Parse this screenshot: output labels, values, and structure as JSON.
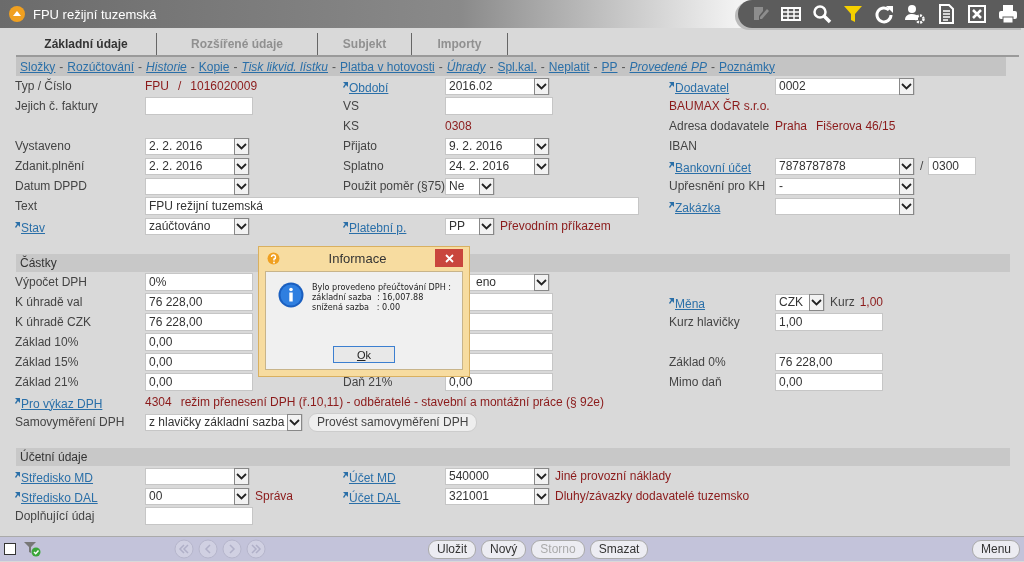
{
  "window": {
    "title": "FPU režijní tuzemská"
  },
  "toolbar": [
    {
      "kind": "edit",
      "disabled": true
    },
    {
      "kind": "table",
      "disabled": false
    },
    {
      "kind": "search",
      "disabled": false
    },
    {
      "kind": "filter",
      "disabled": false
    },
    {
      "kind": "refresh",
      "disabled": false
    },
    {
      "kind": "user-settings",
      "disabled": false
    },
    {
      "kind": "document",
      "disabled": false
    },
    {
      "kind": "excel",
      "disabled": false
    },
    {
      "kind": "print",
      "disabled": false
    }
  ],
  "tabs": [
    {
      "label": "Základní údaje",
      "selected": true
    },
    {
      "label": "Rozšířené údaje",
      "selected": false
    },
    {
      "label": "Subjekt",
      "selected": false
    },
    {
      "label": "Importy",
      "selected": false
    }
  ],
  "links": {
    "separator": "-",
    "items": [
      {
        "label": "Složky",
        "italic": false
      },
      {
        "label": "Rozúčtování",
        "italic": false
      },
      {
        "label": "Historie",
        "italic": true
      },
      {
        "label": "Kopie",
        "italic": false
      },
      {
        "label": "Tisk likvid. lístku",
        "italic": true
      },
      {
        "label": "Platba v hotovosti",
        "italic": false
      },
      {
        "label": "Úhrady",
        "italic": true
      },
      {
        "label": "Spl.kal.",
        "italic": false
      },
      {
        "label": "Neplatit",
        "italic": false
      },
      {
        "label": "PP",
        "italic": false
      },
      {
        "label": "Provedené PP",
        "italic": true
      },
      {
        "label": "Poznámky",
        "italic": false
      }
    ]
  },
  "sections": [
    {
      "rows": [
        {
          "cells": [
            {
              "label": "Typ / Číslo",
              "kind": "plain",
              "fields": [
                {
                  "kind": "text",
                  "text": "FPU"
                },
                {
                  "kind": "text",
                  "text": "/"
                },
                {
                  "kind": "text",
                  "text": "1016020009"
                }
              ]
            },
            {
              "label": "Období",
              "kind": "link",
              "fields": [
                {
                  "kind": "select",
                  "text": "2016.02"
                }
              ]
            },
            {
              "label": "Dodavatel",
              "kind": "link",
              "fields": [
                {
                  "kind": "select",
                  "text": "0002"
                }
              ]
            }
          ]
        },
        {
          "cells": [
            {
              "label": "Jejich č. faktury",
              "kind": "plain",
              "fields": [
                {
                  "kind": "input"
                }
              ]
            },
            {
              "label": "VS",
              "kind": "plain",
              "fields": [
                {
                  "kind": "input"
                }
              ]
            },
            {
              "label": "BAUMAX ČR s.r.o.",
              "kind": "value"
            }
          ]
        },
        {
          "cells": [
            null,
            {
              "label": "KS",
              "kind": "plain",
              "fields": [
                {
                  "kind": "text",
                  "text": "0308"
                }
              ]
            },
            {
              "label": "Adresa dodavatele",
              "kind": "plain",
              "fields": [
                {
                  "kind": "text",
                  "text": "Praha"
                },
                {
                  "kind": "text",
                  "text": "Fišerova 46/15"
                }
              ]
            }
          ]
        },
        {
          "cells": [
            {
              "label": "Vystaveno",
              "kind": "plain",
              "fields": [
                {
                  "kind": "select",
                  "text": "2. 2. 2016"
                }
              ]
            },
            {
              "label": "Přijato",
              "kind": "plain",
              "fields": [
                {
                  "kind": "select",
                  "text": "9. 2. 2016"
                }
              ]
            },
            {
              "label": "IBAN",
              "kind": "plain"
            }
          ]
        },
        {
          "cells": [
            {
              "label": "Zdanit.plnění",
              "kind": "plain",
              "fields": [
                {
                  "kind": "select",
                  "text": "2. 2. 2016"
                }
              ]
            },
            {
              "label": "Splatno",
              "kind": "plain",
              "fields": [
                {
                  "kind": "select",
                  "text": "24. 2. 2016"
                }
              ]
            },
            {
              "label": "Bankovní účet",
              "kind": "link",
              "fields": [
                {
                  "kind": "select",
                  "text": "7878787878"
                },
                {
                  "kind": "sep",
                  "text": "/"
                },
                {
                  "kind": "small-input",
                  "text": "0300"
                }
              ]
            }
          ]
        },
        {
          "cells": [
            {
              "label": "Datum DPPD",
              "kind": "plain",
              "fields": [
                {
                  "kind": "select"
                }
              ]
            },
            {
              "label": "Použit poměr (§75)",
              "kind": "plain",
              "fields": [
                {
                  "kind": "small-select",
                  "text": "Ne"
                }
              ]
            },
            {
              "label": "Upřesnění pro KH",
              "kind": "plain",
              "fields": [
                {
                  "kind": "select",
                  "text": "-"
                }
              ]
            }
          ]
        },
        {
          "cells": [
            {
              "label": "Text",
              "kind": "plain",
              "fields": [
                {
                  "kind": "input",
                  "text": "FPU režijní tuzemská"
                }
              ]
            },
            null,
            {
              "label": "Zakázka",
              "kind": "link",
              "fields": [
                {
                  "kind": "select"
                }
              ]
            }
          ]
        },
        {
          "cells": [
            {
              "label": "Stav",
              "kind": "link",
              "fields": [
                {
                  "kind": "select",
                  "text": "zaúčtováno"
                }
              ]
            },
            {
              "label": "Platební p.",
              "kind": "link",
              "fields": [
                {
                  "kind": "small-select",
                  "text": "PP"
                },
                {
                  "kind": "text",
                  "text": "Převodním příkazem"
                }
              ]
            },
            null
          ]
        }
      ]
    },
    {
      "title": "Částky",
      "rows": [
        {
          "cells": [
            {
              "label": "Výpočet DPH",
              "kind": "plain",
              "fields": [
                {
                  "kind": "input",
                  "text": "0%"
                }
              ]
            },
            {
              "fields": [
                {
                  "kind": "select",
                  "text": "eno",
                  "clipped": true
                }
              ]
            },
            null
          ]
        },
        {
          "cells": [
            {
              "label": "K úhradě val",
              "kind": "plain",
              "fields": [
                {
                  "kind": "input",
                  "text": "76 228,00"
                }
              ]
            },
            {
              "fields": [
                {
                  "kind": "input"
                }
              ]
            },
            {
              "label": "Měna",
              "kind": "link",
              "fields": [
                {
                  "kind": "small-select",
                  "text": "CZK"
                },
                {
                  "kind": "caption",
                  "text": "Kurz"
                },
                {
                  "kind": "text",
                  "text": "1,00"
                }
              ]
            }
          ]
        },
        {
          "cells": [
            {
              "label": "K úhradě CZK",
              "kind": "plain",
              "fields": [
                {
                  "kind": "input",
                  "text": "76 228,00"
                }
              ]
            },
            {
              "fields": [
                {
                  "kind": "input"
                }
              ]
            },
            {
              "label": "Kurz hlavičky",
              "kind": "plain",
              "fields": [
                {
                  "kind": "input",
                  "text": "1,00"
                }
              ]
            }
          ]
        },
        {
          "cells": [
            {
              "label": "Základ 10%",
              "kind": "plain",
              "fields": [
                {
                  "kind": "input",
                  "text": "0,00"
                }
              ]
            },
            {
              "fields": [
                {
                  "kind": "input"
                }
              ]
            },
            null
          ]
        },
        {
          "cells": [
            {
              "label": "Základ 15%",
              "kind": "plain",
              "fields": [
                {
                  "kind": "input",
                  "text": "0,00"
                }
              ]
            },
            {
              "fields": [
                {
                  "kind": "input"
                }
              ]
            },
            {
              "label": "Základ 0%",
              "kind": "plain",
              "fields": [
                {
                  "kind": "input",
                  "text": "76 228,00"
                }
              ]
            }
          ]
        },
        {
          "cells": [
            {
              "label": "Základ 21%",
              "kind": "plain",
              "fields": [
                {
                  "kind": "input",
                  "text": "0,00"
                }
              ]
            },
            {
              "label": "Daň 21%",
              "kind": "plain",
              "fields": [
                {
                  "kind": "input",
                  "text": "0,00"
                }
              ]
            },
            {
              "label": "Mimo daň",
              "kind": "plain",
              "fields": [
                {
                  "kind": "input",
                  "text": "0,00"
                }
              ]
            }
          ]
        },
        {
          "cells": [
            {
              "label": "Pro výkaz DPH",
              "kind": "link",
              "fields": [
                {
                  "kind": "text",
                  "text": "4304"
                },
                {
                  "kind": "text",
                  "text": "režim přenesení DPH (ř.10,11) - odběratelé - stavební a montážní práce (§ 92e)"
                }
              ]
            },
            null,
            null
          ]
        },
        {
          "cells": [
            {
              "label": "Samovyměření DPH",
              "kind": "plain",
              "fields": [
                {
                  "kind": "select",
                  "text": "z hlavičky základní sazba"
                },
                {
                  "kind": "button",
                  "text": "Provést samovyměření DPH"
                }
              ]
            },
            null,
            null
          ]
        }
      ]
    },
    {
      "title": "Účetní údaje",
      "rows": [
        {
          "cells": [
            {
              "label": "Středisko MD",
              "kind": "link",
              "fields": [
                {
                  "kind": "select"
                }
              ]
            },
            {
              "label": "Účet MD",
              "kind": "link",
              "fields": [
                {
                  "kind": "select",
                  "text": "540000"
                },
                {
                  "kind": "text",
                  "text": "Jiné provozní náklady"
                }
              ]
            },
            null
          ]
        },
        {
          "cells": [
            {
              "label": "Středisko DAL",
              "kind": "link",
              "fields": [
                {
                  "kind": "select",
                  "text": "00"
                },
                {
                  "kind": "text",
                  "text": "Správa"
                }
              ]
            },
            {
              "label": "Účet DAL",
              "kind": "link",
              "fields": [
                {
                  "kind": "select",
                  "text": "321001"
                },
                {
                  "kind": "text",
                  "text": "Dluhy/závazky dodavatelé tuzemsko"
                }
              ]
            },
            null
          ]
        },
        {
          "cells": [
            {
              "label": "Doplňující údaj",
              "kind": "plain",
              "fields": [
                {
                  "kind": "input"
                }
              ]
            },
            null,
            null
          ]
        }
      ]
    }
  ],
  "dialog": {
    "title": "Informace",
    "lines": [
      "Bylo provedeno přeúčtování DPH :",
      "základní sazba  : 16,007.88",
      "snížená sazba   : 0.00"
    ],
    "button": "Ok"
  },
  "bottom_bar": {
    "checked": false,
    "nav": [
      {
        "kind": "first",
        "disabled": true
      },
      {
        "kind": "prev",
        "disabled": true
      },
      {
        "kind": "next",
        "disabled": true
      },
      {
        "kind": "last",
        "disabled": true
      }
    ],
    "buttons": [
      {
        "label": "Uložit",
        "disabled": false
      },
      {
        "label": "Nový",
        "disabled": false
      },
      {
        "label": "Storno",
        "disabled": true
      },
      {
        "label": "Smazat",
        "disabled": false
      }
    ],
    "menu": "Menu"
  }
}
